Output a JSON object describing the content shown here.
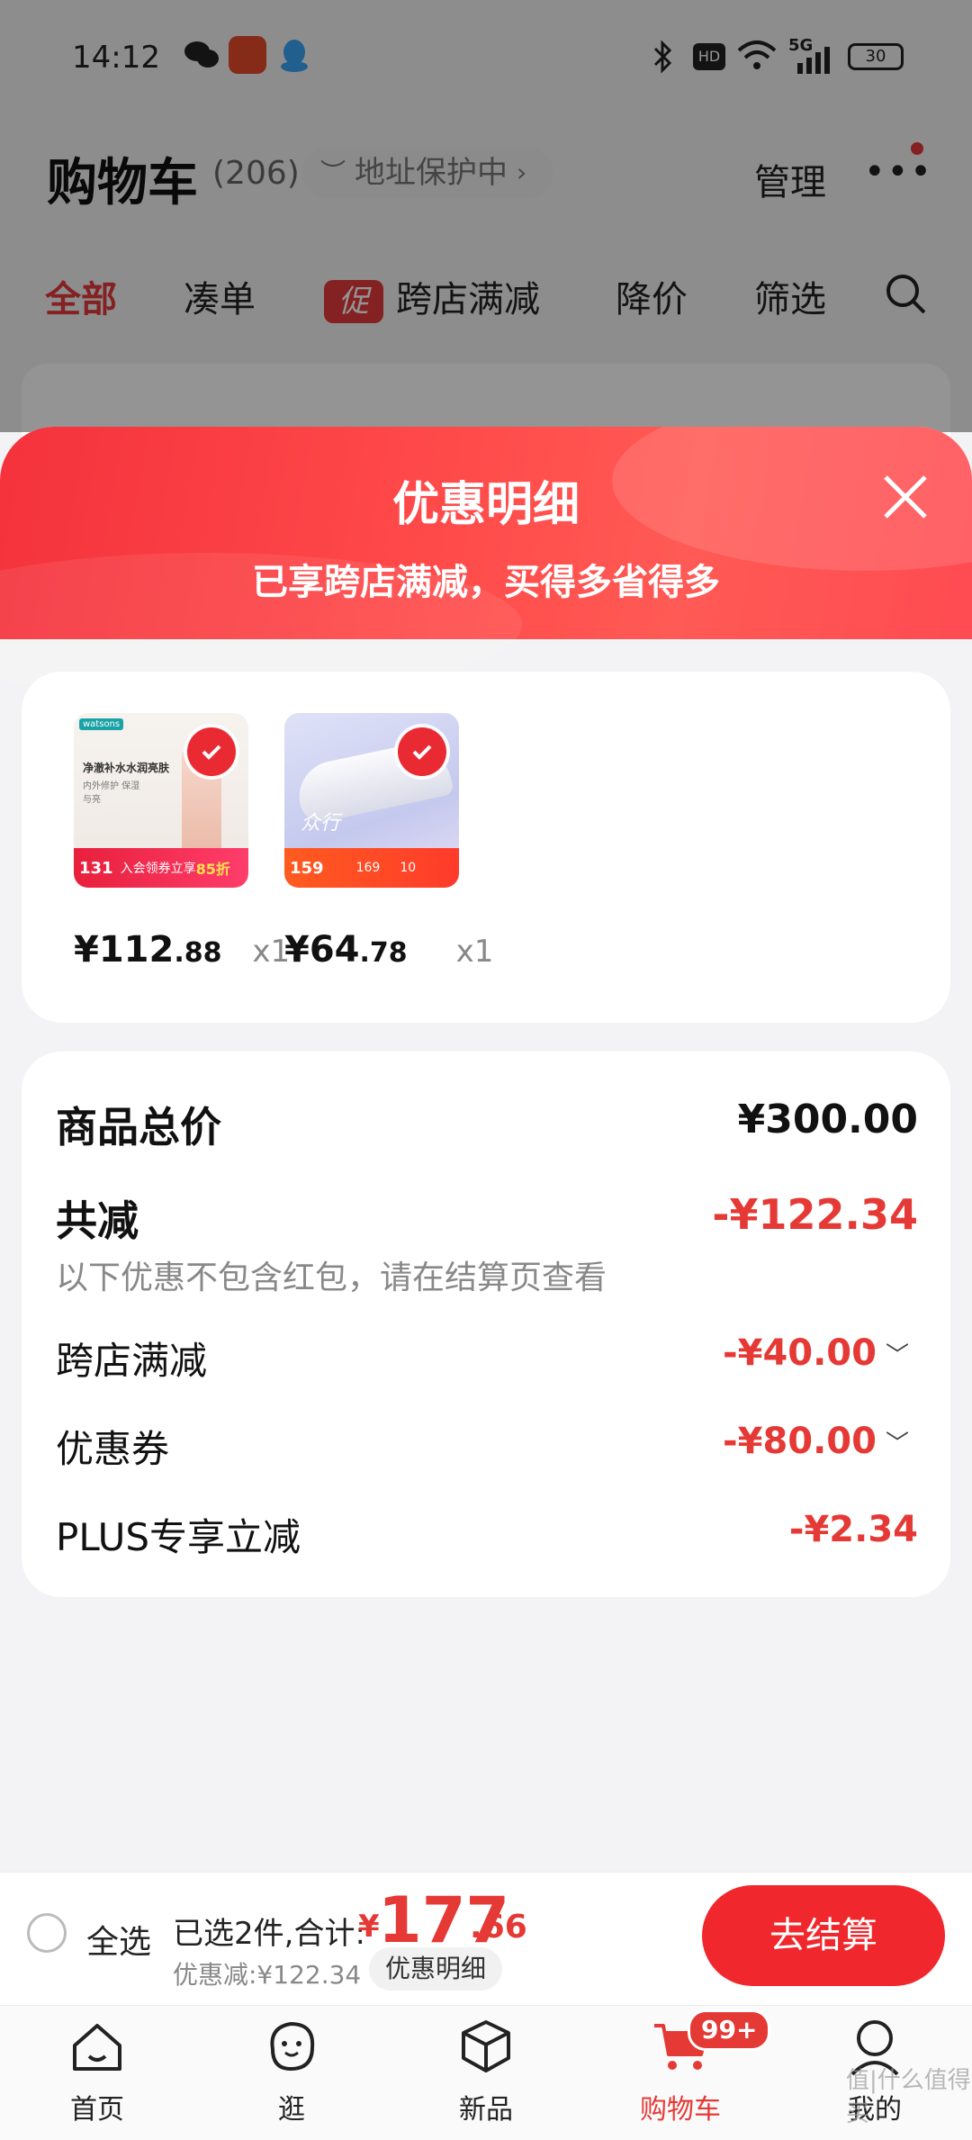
{
  "status_bar": {
    "time": "14:12",
    "network": "5G",
    "battery": "30"
  },
  "cart": {
    "title": "购物车",
    "count": "(206)",
    "address_protect": "地址保护中",
    "manage": "管理",
    "tabs": [
      {
        "label": "全部",
        "active": true
      },
      {
        "label": "凑单"
      },
      {
        "label": "跨店满减",
        "badge": "促"
      },
      {
        "label": "降价"
      },
      {
        "label": "筛选"
      }
    ]
  },
  "sheet": {
    "title": "优惠明细",
    "subtitle": "已享跨店满减，买得多省得多",
    "products": [
      {
        "brand": "watsons",
        "name": "净澈补水水润亮肤",
        "subtext": "内外修护 保湿与亮",
        "badge_price": "131",
        "badge_text": "入会领券立享",
        "badge_discount": "85折",
        "price_int": "¥112",
        "price_dec": ".88",
        "qty": "x1"
      },
      {
        "name": "众行",
        "badge_price": "159",
        "badge_mid": "169",
        "badge_small": "10",
        "price_int": "¥64",
        "price_dec": ".78",
        "qty": "x1"
      }
    ],
    "summary": {
      "total_label": "商品总价",
      "total_value": "¥300.00",
      "reduce_label": "共减",
      "reduce_value": "-¥122.34",
      "reduce_note": "以下优惠不包含红包，请在结算页查看",
      "items": [
        {
          "label": "跨店满减",
          "value": "-¥40.00",
          "expandable": true
        },
        {
          "label": "优惠券",
          "value": "-¥80.00",
          "expandable": true
        },
        {
          "label": "PLUS专享立减",
          "value": "-¥2.34",
          "expandable": false
        }
      ]
    }
  },
  "checkout": {
    "select_all": "全选",
    "selected_text": "已选2件,合计:",
    "total_symbol": "¥",
    "total_int": "177",
    "total_dec": ".66",
    "discount_text": "优惠减:¥122.34",
    "detail_button": "优惠明细",
    "checkout_button": "去结算"
  },
  "nav": {
    "items": [
      {
        "label": "首页",
        "icon": "home-icon"
      },
      {
        "label": "逛",
        "icon": "face-icon"
      },
      {
        "label": "新品",
        "icon": "box-icon"
      },
      {
        "label": "购物车",
        "icon": "cart-icon",
        "active": true,
        "badge": "99+"
      },
      {
        "label": "我的",
        "icon": "person-icon"
      }
    ]
  },
  "watermark": "值|什么值得买",
  "colors": {
    "accent": "#E53935",
    "header_gradient_start": "#F4323C",
    "header_gradient_end": "#FF5A55"
  }
}
